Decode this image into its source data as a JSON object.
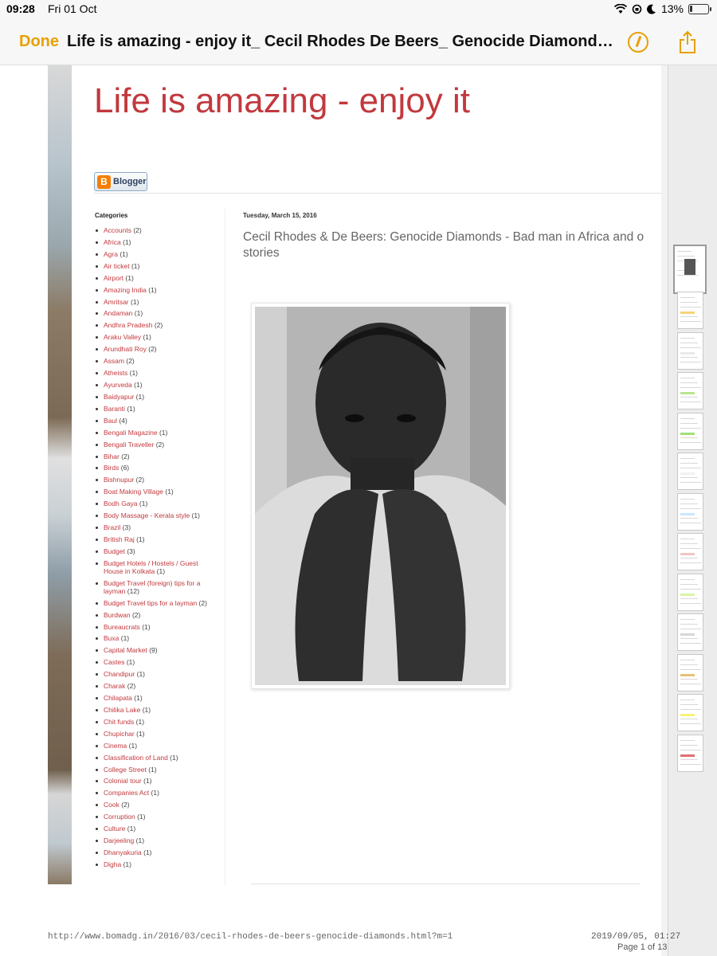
{
  "status_bar": {
    "time": "09:28",
    "date": "Fri 01 Oct",
    "battery_percent": "13%",
    "battery_level": 0.13
  },
  "nav": {
    "done_label": "Done",
    "title": "Life is amazing - enjoy it_ Cecil Rhodes De Beers_ Genocide Diamonds...",
    "accent_color": "#e8a000"
  },
  "blog": {
    "title": "Life is amazing - enjoy it",
    "badge_label": "Blogger",
    "title_color": "#c1393e"
  },
  "sidebar": {
    "heading": "Categories",
    "categories": [
      {
        "name": "Accounts",
        "count": "(2)"
      },
      {
        "name": "Africa",
        "count": "(1)"
      },
      {
        "name": "Agra",
        "count": "(1)"
      },
      {
        "name": "Air ticket",
        "count": "(1)"
      },
      {
        "name": "Airport",
        "count": "(1)"
      },
      {
        "name": "Amazing India",
        "count": "(1)"
      },
      {
        "name": "Amritsar",
        "count": "(1)"
      },
      {
        "name": "Andaman",
        "count": "(1)"
      },
      {
        "name": "Andhra Pradesh",
        "count": "(2)"
      },
      {
        "name": "Araku Valley",
        "count": "(1)"
      },
      {
        "name": "Arundhati Roy",
        "count": "(2)"
      },
      {
        "name": "Assam",
        "count": "(2)"
      },
      {
        "name": "Atheists",
        "count": "(1)"
      },
      {
        "name": "Ayurveda",
        "count": "(1)"
      },
      {
        "name": "Baidyapur",
        "count": "(1)"
      },
      {
        "name": "Baranti",
        "count": "(1)"
      },
      {
        "name": "Baul",
        "count": "(4)"
      },
      {
        "name": "Bengali Magazine",
        "count": "(1)"
      },
      {
        "name": "Bengali Traveller",
        "count": "(2)"
      },
      {
        "name": "Bihar",
        "count": "(2)"
      },
      {
        "name": "Birds",
        "count": "(6)"
      },
      {
        "name": "Bishnupur",
        "count": "(2)"
      },
      {
        "name": "Boat Making Village",
        "count": "(1)"
      },
      {
        "name": "Bodh Gaya",
        "count": "(1)"
      },
      {
        "name": "Body Massage - Kerala style",
        "count": "(1)"
      },
      {
        "name": "Brazil",
        "count": "(3)"
      },
      {
        "name": "British Raj",
        "count": "(1)"
      },
      {
        "name": "Budget",
        "count": "(3)"
      },
      {
        "name": "Budget Hotels / Hostels / Guest House in Kolkata",
        "count": "(1)"
      },
      {
        "name": "Budget Travel (foreign) tips for a layman",
        "count": "(12)"
      },
      {
        "name": "Budget Travel tips for a layman",
        "count": "(2)"
      },
      {
        "name": "Burdwan",
        "count": "(2)"
      },
      {
        "name": "Bureaucrats",
        "count": "(1)"
      },
      {
        "name": "Buxa",
        "count": "(1)"
      },
      {
        "name": "Capital Market",
        "count": "(9)"
      },
      {
        "name": "Castes",
        "count": "(1)"
      },
      {
        "name": "Chandipur",
        "count": "(1)"
      },
      {
        "name": "Charak",
        "count": "(2)"
      },
      {
        "name": "Chilapata",
        "count": "(1)"
      },
      {
        "name": "Chilika Lake",
        "count": "(1)"
      },
      {
        "name": "Chit funds",
        "count": "(1)"
      },
      {
        "name": "Chupichar",
        "count": "(1)"
      },
      {
        "name": "Cinema",
        "count": "(1)"
      },
      {
        "name": "Classification of Land",
        "count": "(1)"
      },
      {
        "name": "College Street",
        "count": "(1)"
      },
      {
        "name": "Colonial tour",
        "count": "(1)"
      },
      {
        "name": "Companies Act",
        "count": "(1)"
      },
      {
        "name": "Cook",
        "count": "(2)"
      },
      {
        "name": "Corruption",
        "count": "(1)"
      },
      {
        "name": "Culture",
        "count": "(1)"
      },
      {
        "name": "Darjeeling",
        "count": "(1)"
      },
      {
        "name": "Dhanyakuria",
        "count": "(1)"
      },
      {
        "name": "Digha",
        "count": "(1)"
      }
    ]
  },
  "post": {
    "date": "Tuesday, March 15, 2016",
    "title": "Cecil Rhodes & De Beers: Genocide Diamonds - Bad man in Africa and o stories"
  },
  "print_footer": {
    "url": "http://www.bomadg.in/2016/03/cecil-rhodes-de-beers-genocide-diamonds.html?m=1",
    "date": "2019/09/05, 01:27",
    "page_indicator": "Page 1 of 13"
  },
  "thumbnails": {
    "count": 13,
    "active_index": 0
  }
}
